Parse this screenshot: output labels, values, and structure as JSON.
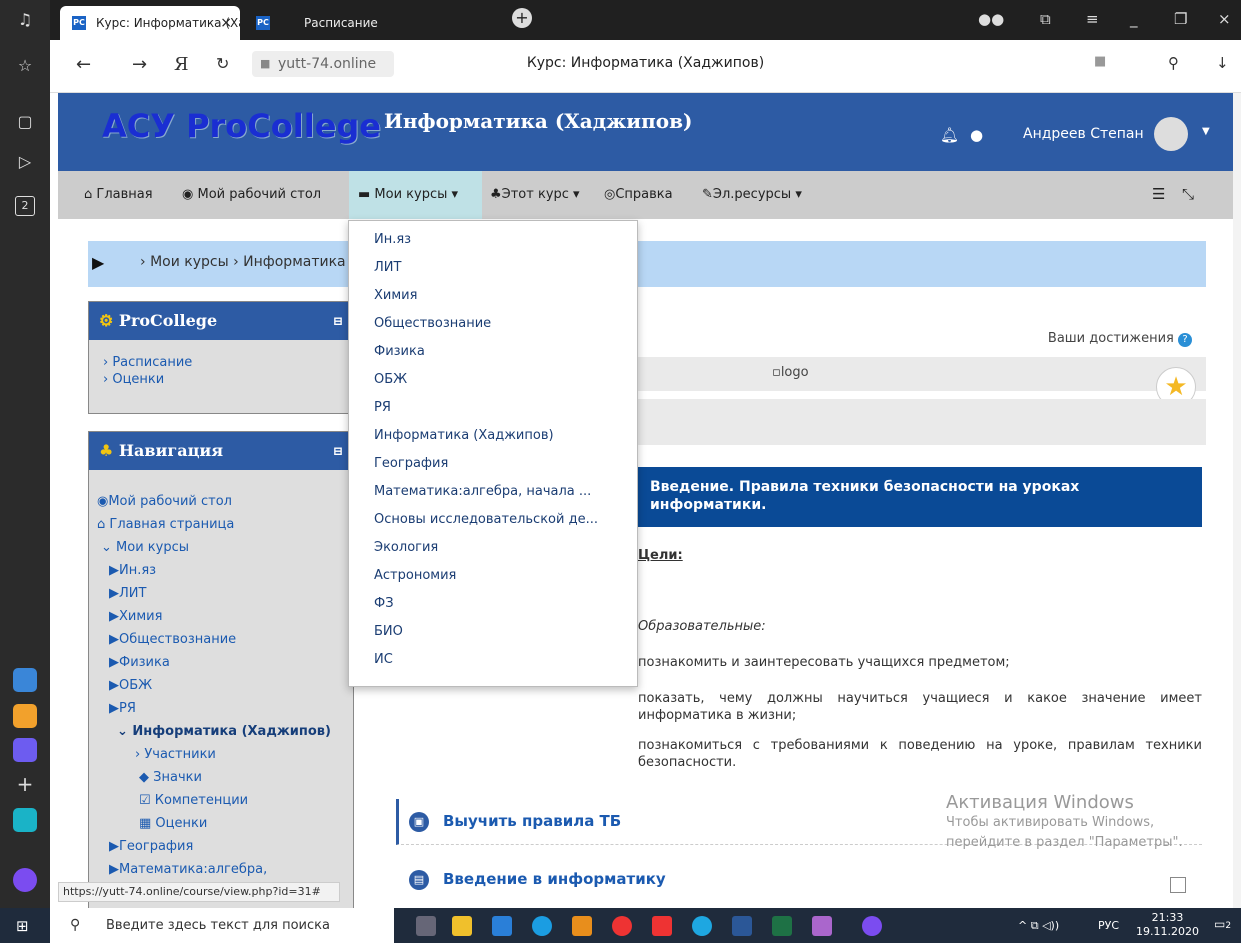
{
  "browser": {
    "tabs": [
      {
        "label": "Курс: Информатика (Ха",
        "active": true
      },
      {
        "label": "Расписание",
        "active": false
      }
    ],
    "url": "yutt-74.online",
    "page_title": "Курс: Информатика (Хаджипов)"
  },
  "site": {
    "logo": "АСУ ProCollege",
    "course_title": "Информатика (Хаджипов)",
    "user_name": "Андреев Степан"
  },
  "nav": {
    "home": "Главная",
    "dashboard": "Мой рабочий стол",
    "my_courses": "Мои курсы",
    "this_course": "Этот курс",
    "help": "Справка",
    "resources": "Эл.ресурсы"
  },
  "breadcrumb": {
    "item1": "Мои курсы",
    "item2": "Информатика"
  },
  "procollege_block": {
    "title": "ProCollege",
    "items": [
      "Расписание",
      "Оценки"
    ]
  },
  "navigation_block": {
    "title": "Навигация",
    "dashboard": "Мой рабочий стол",
    "home": "Главная страница",
    "my_courses": "Мои курсы",
    "courses": [
      "Ин.яз",
      "ЛИТ",
      "Химия",
      "Обществознание",
      "Физика",
      "ОБЖ",
      "РЯ"
    ],
    "current": "Информатика (Хаджипов)",
    "current_children": [
      "Участники",
      "Значки",
      "Компетенции",
      "Оценки"
    ],
    "courses_after": [
      "География",
      "Математика:алгебра,"
    ]
  },
  "dropdown": [
    "Ин.яз",
    "ЛИТ",
    "Химия",
    "Обществознание",
    "Физика",
    "ОБЖ",
    "РЯ",
    "Информатика (Хаджипов)",
    "География",
    "Математика:алгебра, начала ...",
    "Основы исследовательской де...",
    "Экология",
    "Астрономия",
    "ФЗ",
    "БИО",
    "ИС"
  ],
  "main": {
    "achievements": "Ваши достижения",
    "logo_alt": "logo",
    "section_title": "Введение. Правила техники безопасности на уроках информатики.",
    "goals": "Цели:",
    "edu": "Образовательные:",
    "p1": "познакомить и заинтересовать учащихся предметом;",
    "p2": "показать, чему должны научиться учащиеся и какое значение имеет информатика в жизни;",
    "p3": "познакомиться с требованиями к поведению на уроке, правилам техники безопасности.",
    "act1": "Выучить правила ТБ",
    "act2": "Введение в информатику"
  },
  "watermark": {
    "line1": "Активация Windows",
    "line2": "Чтобы активировать Windows,",
    "line3": "перейдите в раздел \"Параметры\"."
  },
  "status_url": "https://yutt-74.online/course/view.php?id=31#",
  "taskbar": {
    "search": "Введите здесь текст для поиска",
    "lang": "РУС",
    "time": "21:33",
    "date": "19.11.2020",
    "notif": "2"
  },
  "colors": {
    "header": "#2d5ba4",
    "section_banner": "#0a4a96",
    "nav_bg": "#cccccc",
    "breadcrumb_bg": "#b8d7f5"
  }
}
